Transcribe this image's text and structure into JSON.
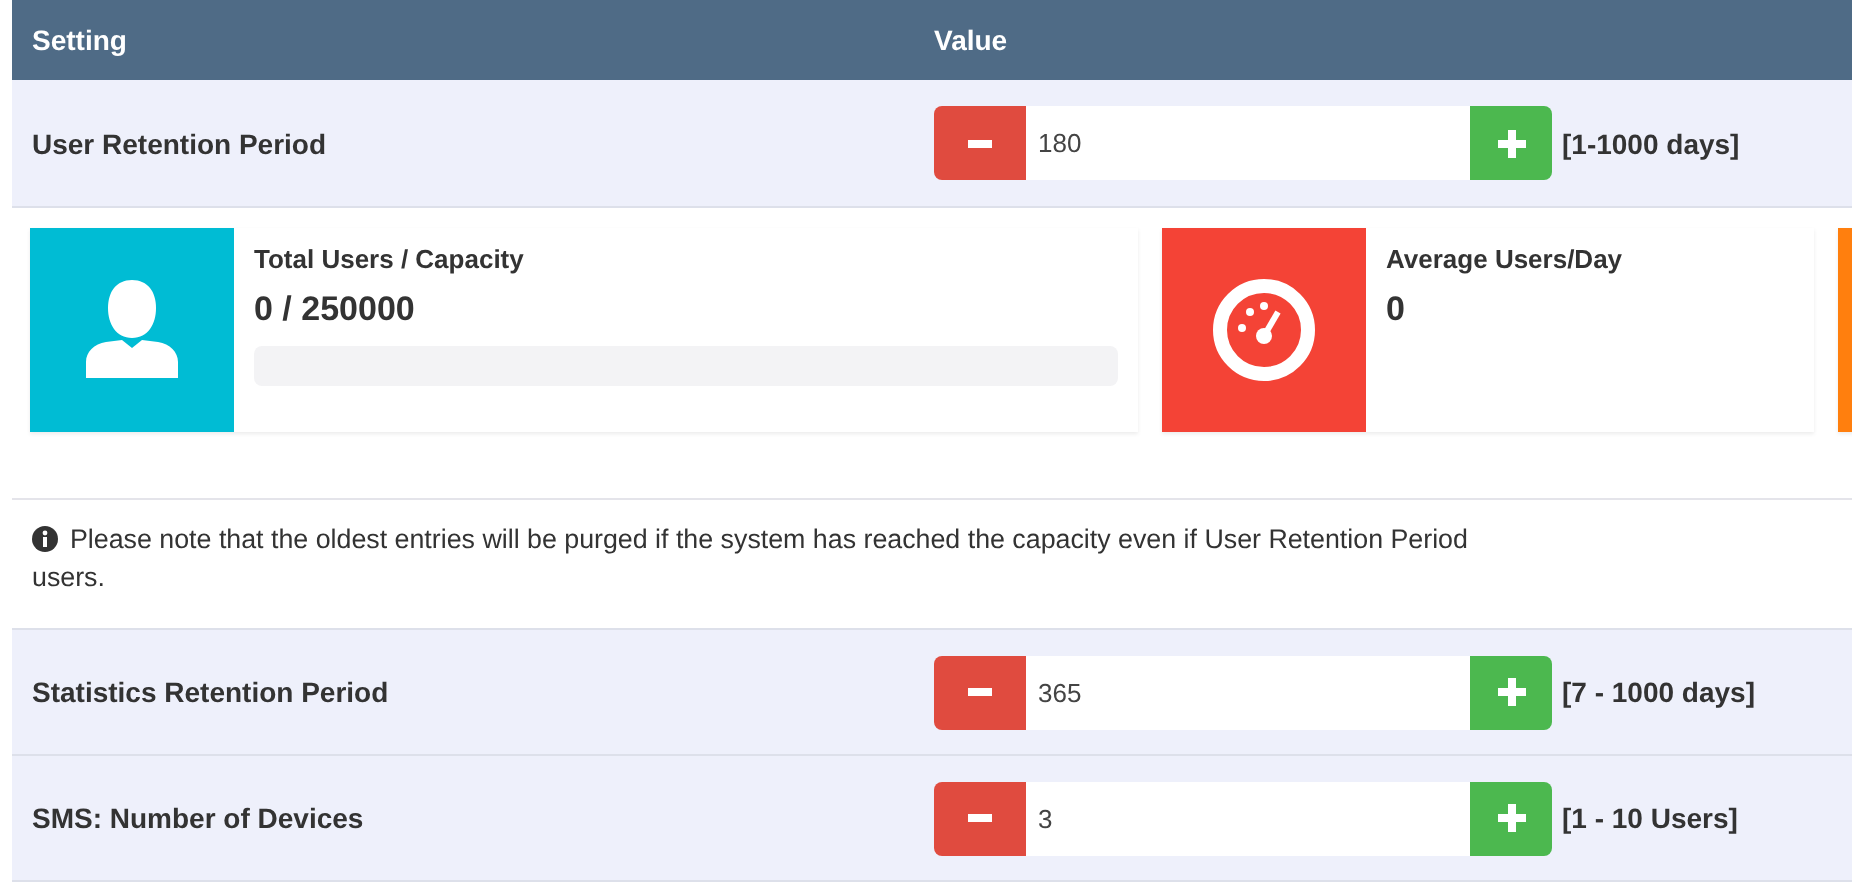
{
  "table": {
    "columns": [
      "Setting",
      "Value"
    ],
    "rows": [
      {
        "label": "User Retention Period",
        "value": "180",
        "range": "[1-1000 days]"
      }
    ]
  },
  "stats": [
    {
      "title": "Total Users / Capacity",
      "value": "0 / 250000",
      "color": "#00bcd4",
      "level": 0
    },
    {
      "title": "Average Users/Day",
      "value": "0",
      "color": "#f44336"
    },
    {
      "color": "#ff7f0e"
    }
  ],
  "note": {
    "lines": [
      "Please note that the oldest entries will be purged if the system has reached the capacity even if User Retention Period",
      "users."
    ]
  },
  "more_rows": [
    {
      "label": "Statistics Retention Period",
      "value": "365",
      "range": "[7 - 1000 days]"
    },
    {
      "label": "SMS: Number of Devices",
      "value": "3",
      "range": "[1 - 10 Users]"
    }
  ]
}
